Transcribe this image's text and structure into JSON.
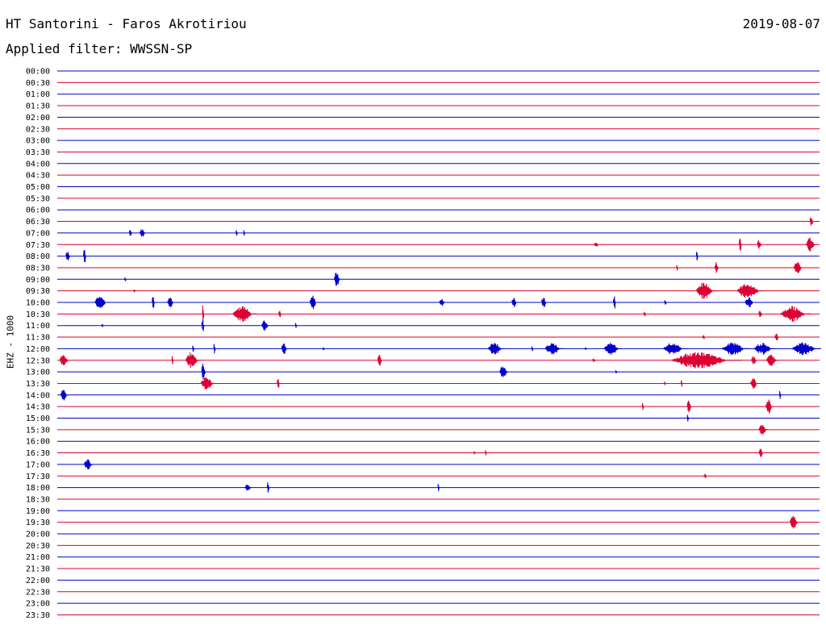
{
  "header": {
    "title": "HT Santorini - Faros Akrotiriou",
    "date": "2019-08-07",
    "filter": "Applied filter: WWSSN-SP"
  },
  "chart_data": {
    "type": "line",
    "channel_label": "EHZ - 1000",
    "colors": {
      "even": "#0000cc",
      "odd": "#dd0033"
    },
    "rows": [
      {
        "label": "00:00",
        "events": []
      },
      {
        "label": "00:30",
        "events": []
      },
      {
        "label": "01:00",
        "events": []
      },
      {
        "label": "01:30",
        "events": []
      },
      {
        "label": "02:00",
        "events": []
      },
      {
        "label": "02:30",
        "events": []
      },
      {
        "label": "03:00",
        "events": []
      },
      {
        "label": "03:30",
        "events": []
      },
      {
        "label": "04:00",
        "events": []
      },
      {
        "label": "04:30",
        "events": []
      },
      {
        "label": "05:00",
        "events": []
      },
      {
        "label": "05:30",
        "events": []
      },
      {
        "label": "06:00",
        "events": []
      },
      {
        "label": "06:30",
        "events": [
          [
            0.987,
            0.005,
            0.8
          ]
        ]
      },
      {
        "label": "07:00",
        "events": [
          [
            0.094,
            0.004,
            0.8
          ],
          [
            0.108,
            0.008,
            0.6
          ],
          [
            0.234,
            0.002,
            0.5
          ],
          [
            0.244,
            0.002,
            0.4
          ]
        ]
      },
      {
        "label": "07:30",
        "events": [
          [
            0.704,
            0.006,
            0.4
          ],
          [
            0.894,
            0.004,
            1.0
          ],
          [
            0.918,
            0.006,
            0.7
          ],
          [
            0.982,
            0.014,
            1.0
          ]
        ]
      },
      {
        "label": "08:00",
        "events": [
          [
            0.011,
            0.006,
            0.9
          ],
          [
            0.034,
            0.004,
            1.0
          ],
          [
            0.838,
            0.002,
            1.2
          ]
        ]
      },
      {
        "label": "08:30",
        "events": [
          [
            0.812,
            0.002,
            0.4
          ],
          [
            0.862,
            0.006,
            0.8
          ],
          [
            0.966,
            0.012,
            1.0
          ]
        ]
      },
      {
        "label": "09:00",
        "events": [
          [
            0.088,
            0.002,
            0.5
          ],
          [
            0.363,
            0.009,
            1.2
          ]
        ]
      },
      {
        "label": "09:30",
        "events": [
          [
            0.1,
            0.002,
            0.3
          ],
          [
            0.838,
            0.027,
            1.2
          ],
          [
            0.892,
            0.036,
            1.2
          ]
        ]
      },
      {
        "label": "10:00",
        "events": [
          [
            0.049,
            0.018,
            1.0
          ],
          [
            0.124,
            0.004,
            0.9
          ],
          [
            0.144,
            0.01,
            0.8
          ],
          [
            0.331,
            0.01,
            1.1
          ],
          [
            0.501,
            0.008,
            0.6
          ],
          [
            0.596,
            0.007,
            0.7
          ],
          [
            0.635,
            0.007,
            0.8
          ],
          [
            0.729,
            0.004,
            1.0
          ],
          [
            0.796,
            0.003,
            0.4
          ],
          [
            0.902,
            0.013,
            0.8
          ]
        ]
      },
      {
        "label": "10:30",
        "events": [
          [
            0.19,
            0.002,
            1.4
          ],
          [
            0.23,
            0.032,
            1.1
          ],
          [
            0.29,
            0.004,
            0.6
          ],
          [
            0.769,
            0.003,
            0.4
          ],
          [
            0.92,
            0.005,
            0.6
          ],
          [
            0.949,
            0.04,
            1.1
          ]
        ]
      },
      {
        "label": "11:00",
        "events": [
          [
            0.058,
            0.002,
            0.4
          ],
          [
            0.189,
            0.004,
            1.0
          ],
          [
            0.268,
            0.01,
            0.9
          ],
          [
            0.312,
            0.002,
            0.4
          ]
        ]
      },
      {
        "label": "11:30",
        "events": [
          [
            0.846,
            0.004,
            0.3
          ],
          [
            0.941,
            0.006,
            0.5
          ]
        ]
      },
      {
        "label": "12:00",
        "events": [
          [
            0.177,
            0.002,
            0.6
          ],
          [
            0.205,
            0.002,
            0.8
          ],
          [
            0.294,
            0.008,
            0.8
          ],
          [
            0.348,
            0.002,
            0.3
          ],
          [
            0.565,
            0.022,
            0.9
          ],
          [
            0.622,
            0.002,
            0.4
          ],
          [
            0.64,
            0.024,
            0.9
          ],
          [
            0.692,
            0.002,
            0.3
          ],
          [
            0.717,
            0.024,
            0.9
          ],
          [
            0.795,
            0.031,
            0.9
          ],
          [
            0.872,
            0.036,
            0.9
          ],
          [
            0.914,
            0.028,
            0.9
          ],
          [
            0.964,
            0.038,
            0.9
          ]
        ]
      },
      {
        "label": "12:30",
        "events": [
          [
            0.003,
            0.013,
            0.9
          ],
          [
            0.15,
            0.002,
            0.6
          ],
          [
            0.168,
            0.02,
            1.1
          ],
          [
            0.42,
            0.006,
            1.0
          ],
          [
            0.702,
            0.004,
            0.3
          ],
          [
            0.806,
            0.092,
            1.2
          ],
          [
            0.91,
            0.008,
            0.6
          ],
          [
            0.93,
            0.016,
            0.8
          ]
        ]
      },
      {
        "label": "13:00",
        "events": [
          [
            0.189,
            0.006,
            1.2
          ],
          [
            0.58,
            0.012,
            1.1
          ],
          [
            0.732,
            0.002,
            0.3
          ]
        ]
      },
      {
        "label": "13:30",
        "events": [
          [
            0.188,
            0.02,
            0.9
          ],
          [
            0.288,
            0.004,
            0.8
          ],
          [
            0.796,
            0.002,
            0.3
          ],
          [
            0.818,
            0.002,
            0.5
          ],
          [
            0.909,
            0.01,
            0.9
          ]
        ]
      },
      {
        "label": "14:00",
        "events": [
          [
            0.004,
            0.01,
            0.8
          ],
          [
            0.947,
            0.002,
            0.7
          ]
        ]
      },
      {
        "label": "14:30",
        "events": [
          [
            0.767,
            0.002,
            0.6
          ],
          [
            0.826,
            0.006,
            1.0
          ],
          [
            0.929,
            0.01,
            1.1
          ]
        ]
      },
      {
        "label": "15:00",
        "events": [
          [
            0.826,
            0.002,
            0.5
          ]
        ]
      },
      {
        "label": "15:30",
        "events": [
          [
            0.92,
            0.012,
            0.8
          ]
        ]
      },
      {
        "label": "16:00",
        "events": []
      },
      {
        "label": "16:30",
        "events": [
          [
            0.546,
            0.002,
            0.3
          ],
          [
            0.561,
            0.002,
            0.4
          ],
          [
            0.92,
            0.006,
            0.8
          ]
        ]
      },
      {
        "label": "17:00",
        "events": [
          [
            0.035,
            0.012,
            0.8
          ]
        ]
      },
      {
        "label": "17:30",
        "events": [
          [
            0.848,
            0.004,
            0.4
          ]
        ]
      },
      {
        "label": "18:00",
        "events": [
          [
            0.246,
            0.009,
            0.6
          ],
          [
            0.275,
            0.003,
            1.0
          ],
          [
            0.499,
            0.002,
            0.6
          ]
        ]
      },
      {
        "label": "18:30",
        "events": []
      },
      {
        "label": "19:00",
        "events": []
      },
      {
        "label": "19:30",
        "events": [
          [
            0.961,
            0.012,
            1.1
          ]
        ]
      },
      {
        "label": "20:00",
        "events": []
      },
      {
        "label": "20:30",
        "events": []
      },
      {
        "label": "21:00",
        "events": []
      },
      {
        "label": "21:30",
        "events": []
      },
      {
        "label": "22:00",
        "events": []
      },
      {
        "label": "22:30",
        "events": []
      },
      {
        "label": "23:00",
        "events": []
      },
      {
        "label": "23:30",
        "events": []
      }
    ]
  }
}
